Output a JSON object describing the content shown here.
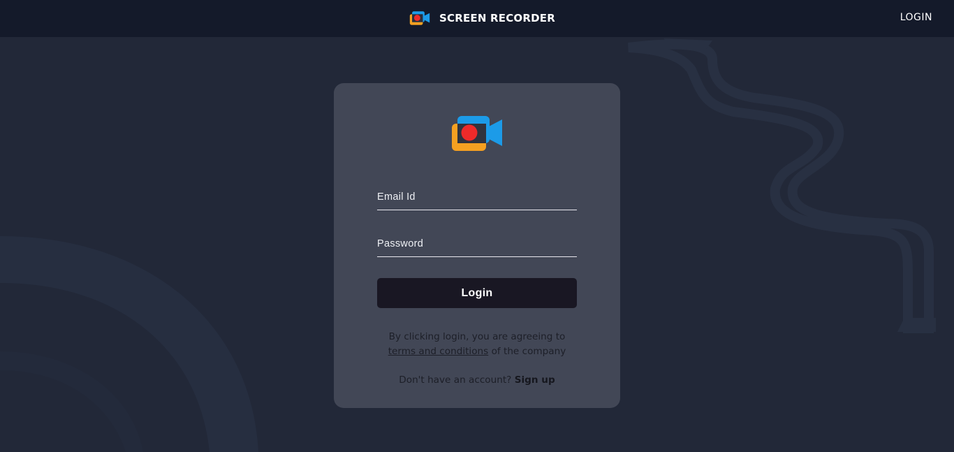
{
  "header": {
    "brand_title": "SCREEN RECORDER",
    "brand_logo_icon": "video-camera-record-icon",
    "nav_login_label": "LOGIN"
  },
  "login_card": {
    "logo_icon": "video-camera-record-icon",
    "email_label": "Email Id",
    "password_label": "Password",
    "login_button_label": "Login",
    "terms_prefix": "By clicking login, you are agreeing to",
    "terms_link_label": "terms and conditions",
    "terms_suffix": "of the company",
    "signup_prompt": "Don't have an account?",
    "signup_link_label": "Sign up"
  },
  "colors": {
    "page_background": "#222838",
    "header_background": "#141a2a",
    "card_background": "#424756",
    "button_background": "#191723",
    "logo_blue": "#1c9be8",
    "logo_orange": "#f5a021",
    "logo_red": "#ee2a2a"
  }
}
